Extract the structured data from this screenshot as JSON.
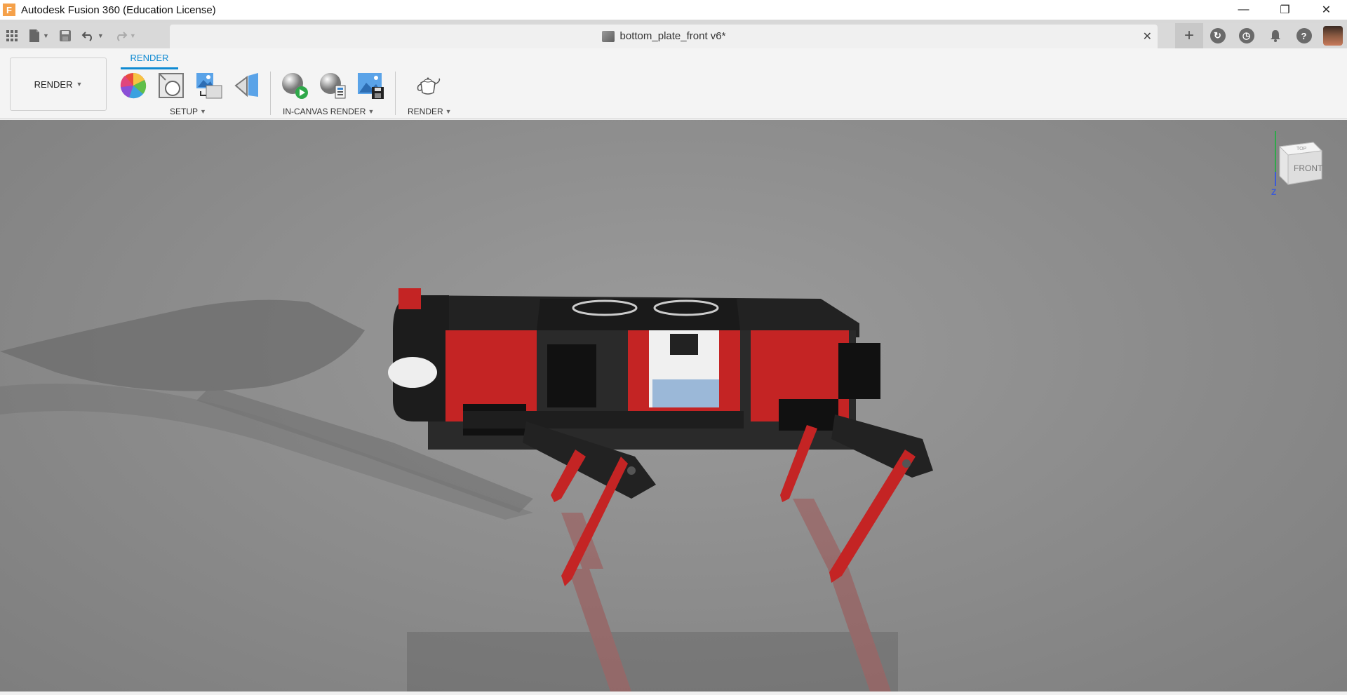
{
  "window": {
    "title": "Autodesk Fusion 360 (Education License)",
    "logo_letter": "F",
    "minimize": "—",
    "restore": "❐",
    "close": "✕"
  },
  "document": {
    "tab_title": "bottom_plate_front v6*",
    "close": "✕"
  },
  "quick_access": {
    "icons": [
      "grid-apps-icon",
      "file-icon",
      "save-icon",
      "undo-icon",
      "redo-icon"
    ]
  },
  "header_icons": [
    "new-tab-plus-icon",
    "extensions-icon",
    "job-status-icon",
    "notifications-icon",
    "help-icon",
    "user-avatar"
  ],
  "toolbar": {
    "workspace_label": "RENDER",
    "active_tab": "RENDER",
    "groups": {
      "setup": "SETUP",
      "in_canvas_render": "IN-CANVAS RENDER",
      "render": "RENDER"
    },
    "tools": [
      "appearance-icon",
      "scene-settings-icon",
      "texture-map-icon",
      "decal-icon",
      "in-canvas-render-icon",
      "render-settings-icon",
      "capture-image-icon",
      "render-teapot-icon"
    ]
  },
  "viewcube": {
    "face_front": "FRONT",
    "face_top": "TOP",
    "axis_z": "Z"
  },
  "colors": {
    "accent": "#0f8ad2",
    "robot_red": "#c42424",
    "canvas_gray": "#8e8e8e"
  }
}
